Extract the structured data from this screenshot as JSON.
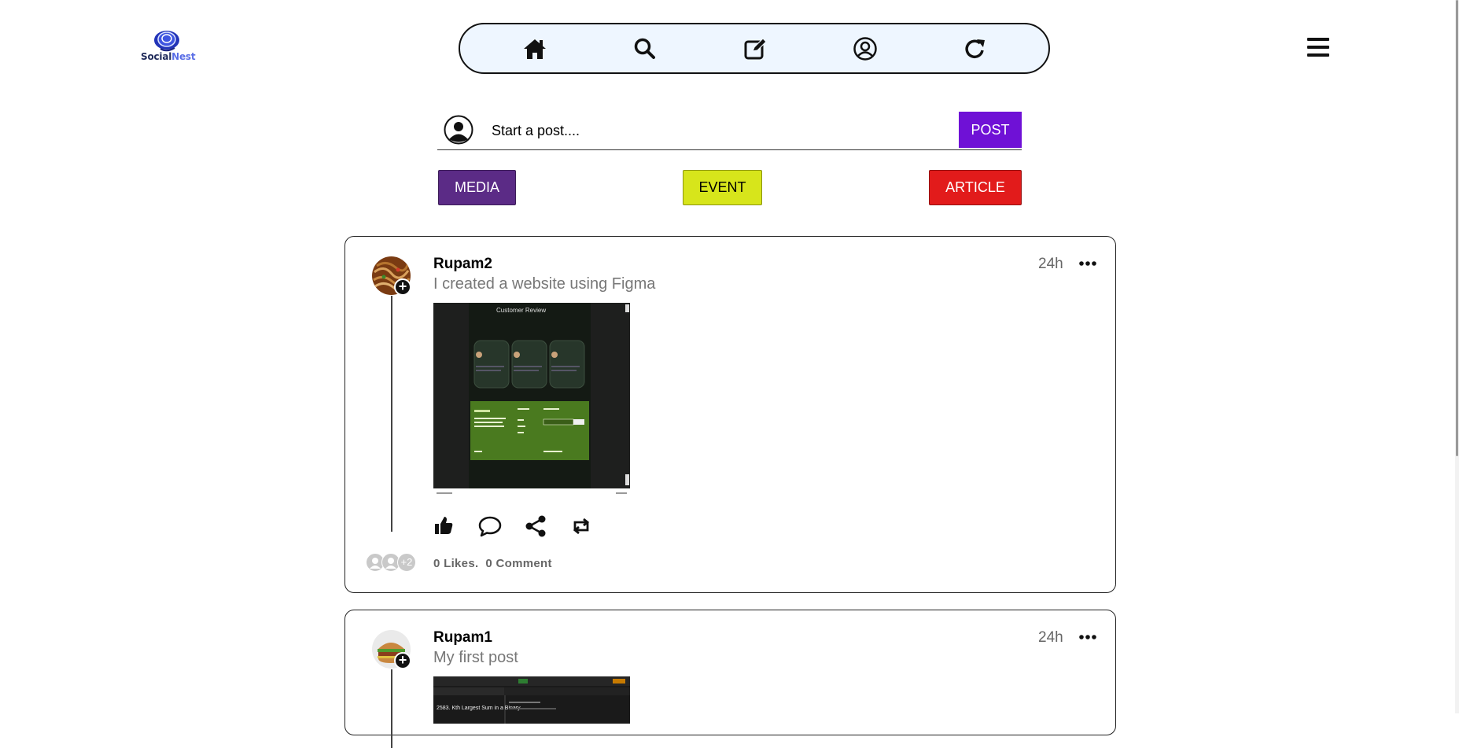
{
  "brand": {
    "name_part1": "Social",
    "name_part2": "Nest",
    "color_dark": "#1f2a5a",
    "color_accent": "#5a6ee6"
  },
  "nav": {
    "items": [
      {
        "icon": "home-icon"
      },
      {
        "icon": "search-icon"
      },
      {
        "icon": "edit-icon"
      },
      {
        "icon": "profile-icon"
      },
      {
        "icon": "refresh-icon"
      }
    ],
    "menu_icon": "hamburger-icon"
  },
  "composer": {
    "placeholder": "Start a post....",
    "post_label": "POST",
    "post_color": "#6f11d6"
  },
  "actions": {
    "media_label": "MEDIA",
    "event_label": "EVENT",
    "article_label": "ARTICLE",
    "media_color": "#5b2b86",
    "event_color": "#d7e51b",
    "article_color": "#e21b1b"
  },
  "posts": [
    {
      "author": "Rupam2",
      "text": "I created a website using Figma",
      "time": "24h",
      "likes_text": "0 Likes.",
      "comments_text": "0 Comment",
      "likers_extra": "+2",
      "image_title": "Customer Review"
    },
    {
      "author": "Rupam1",
      "text": "My first post",
      "time": "24h",
      "image_caption": "2583. Kth Largest Sum in a Binary"
    }
  ]
}
